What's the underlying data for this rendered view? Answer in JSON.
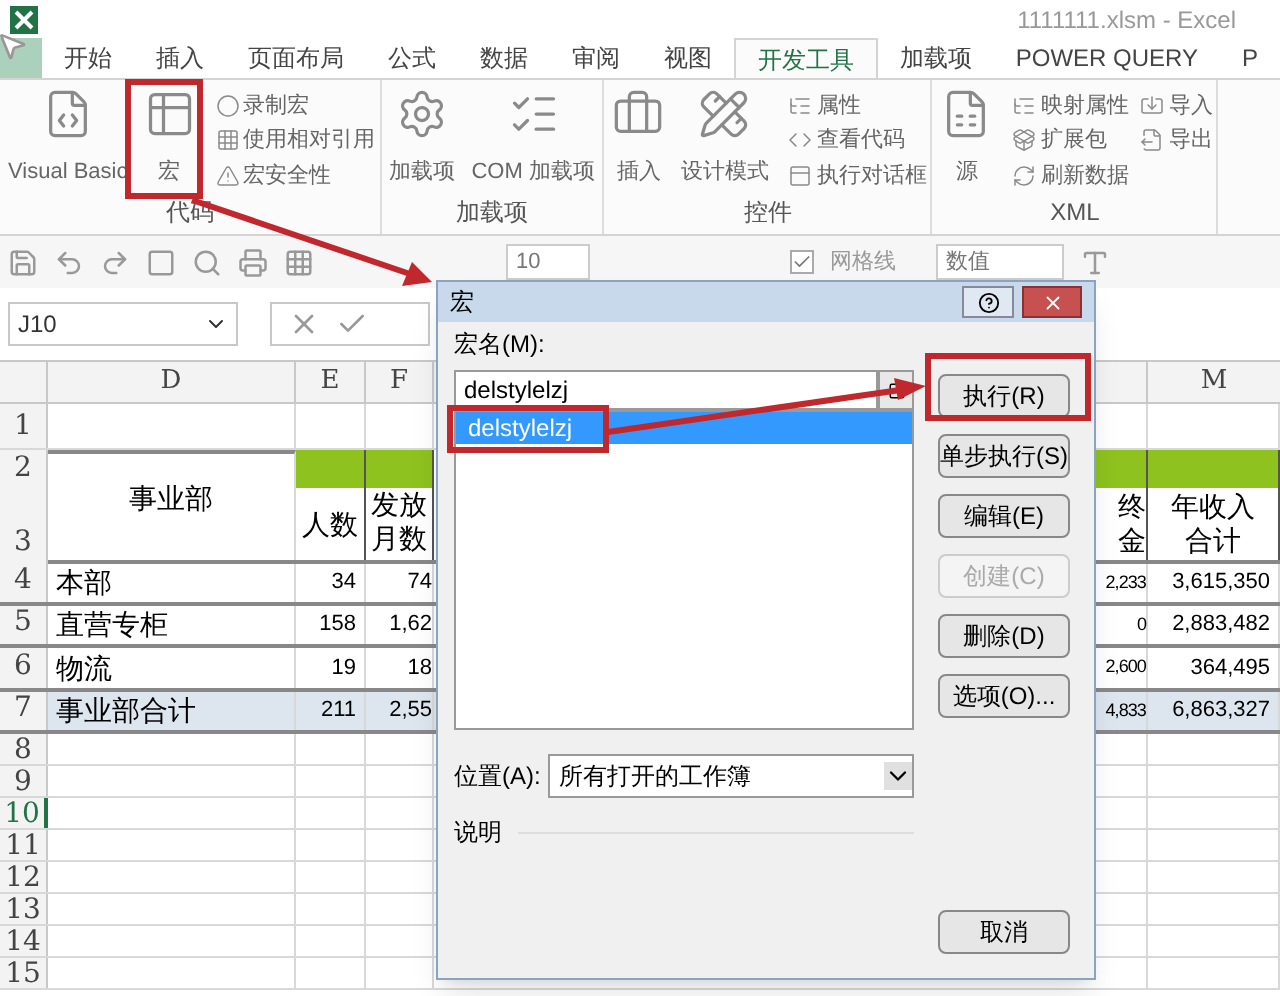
{
  "window": {
    "title": "1111111.xlsm - Excel"
  },
  "tabs": [
    {
      "label": "开始",
      "selected": false
    },
    {
      "label": "插入",
      "selected": false
    },
    {
      "label": "页面布局",
      "selected": false
    },
    {
      "label": "公式",
      "selected": false
    },
    {
      "label": "数据",
      "selected": false
    },
    {
      "label": "审阅",
      "selected": false
    },
    {
      "label": "视图",
      "selected": false
    },
    {
      "label": "开发工具",
      "selected": true
    },
    {
      "label": "加载项",
      "selected": false
    },
    {
      "label": "POWER QUERY",
      "selected": false
    },
    {
      "label": "P",
      "selected": false
    }
  ],
  "ribbon": [
    {
      "label": "代码",
      "large": [
        {
          "label": "Visual Basic"
        },
        {
          "label": "宏"
        }
      ],
      "small": [
        {
          "label": "录制宏"
        },
        {
          "label": "使用相对引用"
        },
        {
          "label": "宏安全性"
        }
      ]
    },
    {
      "label": "加载项",
      "large": [
        {
          "label": "加载项"
        },
        {
          "label": "COM 加载项"
        }
      ]
    },
    {
      "label": "控件",
      "large": [
        {
          "label": "插入"
        },
        {
          "label": "设计模式"
        }
      ],
      "small": [
        {
          "label": "属性"
        },
        {
          "label": "查看代码"
        },
        {
          "label": "执行对话框"
        }
      ]
    },
    {
      "label": "XML",
      "large": [
        {
          "label": "源"
        }
      ],
      "small": [
        {
          "label": "映射属性"
        },
        {
          "label": "扩展包"
        },
        {
          "label": "刷新数据"
        },
        {
          "label": "导入"
        },
        {
          "label": "导出"
        }
      ]
    }
  ],
  "toolbar": {
    "font_size": "10",
    "gridlines": {
      "label": "网格线",
      "checked": true
    },
    "number_format": "数值"
  },
  "formula_bar": {
    "name_box": "J10"
  },
  "sheet": {
    "columns": [
      "D",
      "E",
      "F",
      "M"
    ],
    "header": {
      "department": "事业部",
      "count": "人数",
      "months": [
        "发放",
        "月数"
      ],
      "bonus": [
        "终",
        "金"
      ],
      "income": [
        "年收入",
        "合计"
      ]
    },
    "row_numbers": [
      {
        "label": "1",
        "selected": false
      },
      {
        "label": "2",
        "selected": false
      },
      {
        "label": "3",
        "selected": false
      },
      {
        "label": "4",
        "selected": false
      },
      {
        "label": "5",
        "selected": false
      },
      {
        "label": "6",
        "selected": false
      },
      {
        "label": "7",
        "selected": false
      },
      {
        "label": "8",
        "selected": false
      },
      {
        "label": "9",
        "selected": false
      },
      {
        "label": "10",
        "selected": true
      },
      {
        "label": "11",
        "selected": false
      },
      {
        "label": "12",
        "selected": false
      },
      {
        "label": "13",
        "selected": false
      },
      {
        "label": "14",
        "selected": false
      },
      {
        "label": "15",
        "selected": false
      }
    ],
    "rows": [
      {
        "name": "本部",
        "count": "34",
        "months": "74",
        "bonus": "2,233",
        "income": "3,615,350",
        "total": false
      },
      {
        "name": "直营专柜",
        "count": "158",
        "months": "1,62",
        "bonus": "0",
        "income": "2,883,482",
        "total": false
      },
      {
        "name": "物流",
        "count": "19",
        "months": "18",
        "bonus": "2,600",
        "income": "364,495",
        "total": false
      },
      {
        "name": "事业部合计",
        "count": "211",
        "months": "2,55",
        "bonus": "4,833",
        "income": "6,863,327",
        "total": true
      }
    ]
  },
  "dialog": {
    "title": "宏",
    "name_label": "宏名(M):",
    "name_value": "delstylelzj",
    "macros": [
      {
        "label": "delstylelzj",
        "selected": true
      }
    ],
    "buttons": [
      {
        "label": "执行(R)",
        "disabled": false
      },
      {
        "label": "单步执行(S)",
        "disabled": false
      },
      {
        "label": "编辑(E)",
        "disabled": false
      },
      {
        "label": "创建(C)",
        "disabled": true
      },
      {
        "label": "删除(D)",
        "disabled": false
      },
      {
        "label": "选项(O)...",
        "disabled": false
      }
    ],
    "location_label": "位置(A):",
    "location_value": "所有打开的工作簿",
    "description_label": "说明",
    "cancel": "取消"
  }
}
